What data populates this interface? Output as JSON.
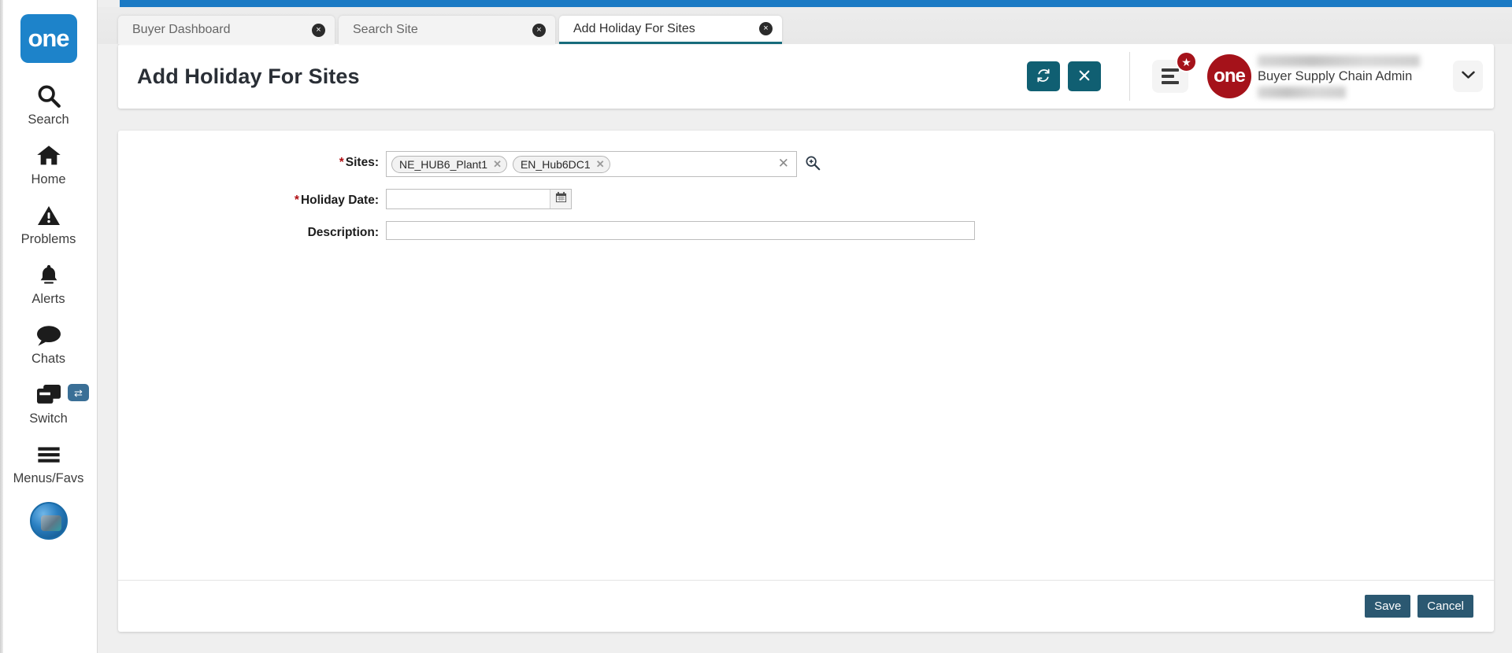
{
  "sidebar": {
    "logo_text": "one",
    "items": [
      {
        "label": "Search",
        "icon": "search-icon"
      },
      {
        "label": "Home",
        "icon": "home-icon"
      },
      {
        "label": "Problems",
        "icon": "warning-triangle-icon"
      },
      {
        "label": "Alerts",
        "icon": "bell-icon"
      },
      {
        "label": "Chats",
        "icon": "chat-bubble-icon"
      },
      {
        "label": "Switch",
        "icon": "windows-stack-icon",
        "badge": "⇄"
      },
      {
        "label": "Menus/Favs",
        "icon": "hamburger-icon"
      }
    ],
    "avatar": "user-avatar"
  },
  "tabs": [
    {
      "label": "Buyer Dashboard",
      "active": false,
      "close": "×"
    },
    {
      "label": "Search Site",
      "active": false,
      "close": "×"
    },
    {
      "label": "Add Holiday For Sites",
      "active": true,
      "close": "×"
    }
  ],
  "header": {
    "title": "Add Holiday For Sites",
    "refresh_icon": "refresh-icon",
    "close_icon": "close-icon",
    "menu_icon": "hamburger-menu-icon",
    "favorites_badge": "★",
    "brand_logo": "one",
    "user_name_masked": "",
    "user_role": "Buyer Supply Chain Admin",
    "chevron": "❯"
  },
  "form": {
    "sites": {
      "label": "Sites:",
      "required": true,
      "chips": [
        {
          "text": "NE_HUB6_Plant1",
          "remove": "✕"
        },
        {
          "text": "EN_Hub6DC1",
          "remove": "✕"
        }
      ],
      "clear": "✕",
      "lookup_icon": "search-lookup-icon",
      "input_value": "",
      "placeholder": ""
    },
    "holiday_date": {
      "label": "Holiday Date:",
      "required": true,
      "value": "",
      "placeholder": "",
      "calendar_icon": "calendar-icon"
    },
    "description": {
      "label": "Description:",
      "required": false,
      "value": "",
      "placeholder": ""
    }
  },
  "footer": {
    "save_label": "Save",
    "cancel_label": "Cancel"
  },
  "colors": {
    "top_bar_blue": "#1b7ac4",
    "rail_logo_blue": "#1d83ca",
    "header_action_teal": "#105f72",
    "active_tab_underline": "#176b7c",
    "brand_red": "#a5121a",
    "footer_button": "#2b5871",
    "required_asterisk": "#b00f14"
  }
}
